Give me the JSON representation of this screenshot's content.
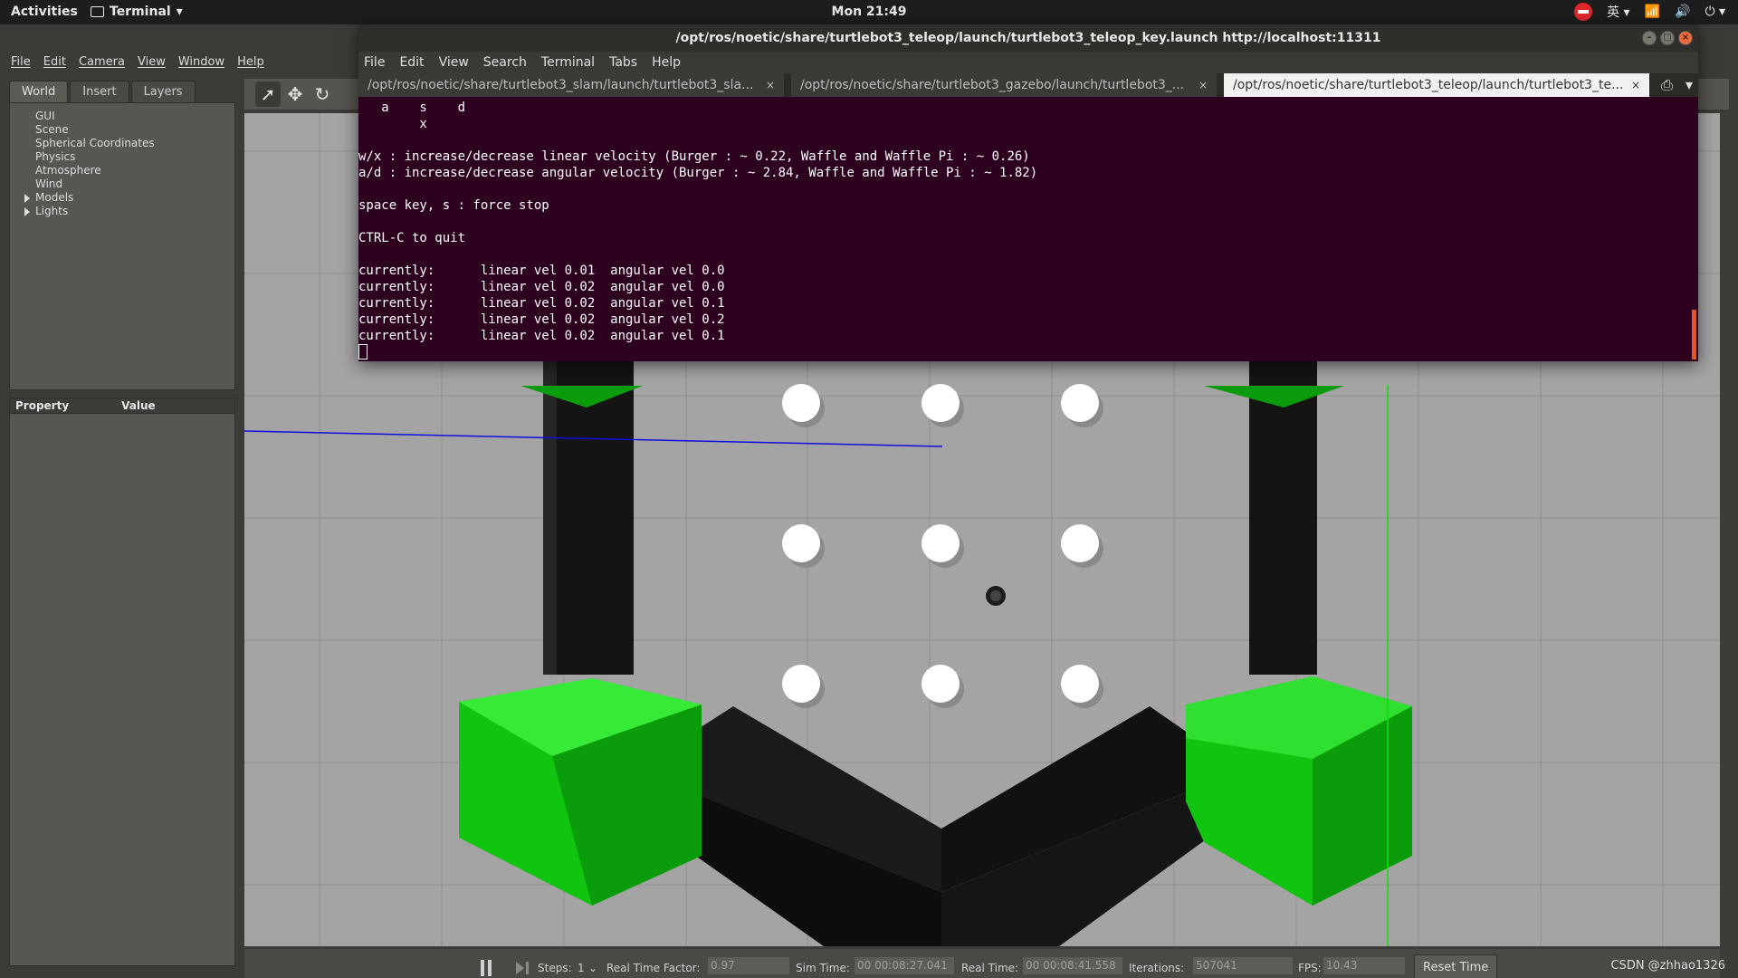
{
  "topbar": {
    "activities": "Activities",
    "app_menu": "Terminal",
    "clock": "Mon 21:49",
    "ime": "英"
  },
  "gazebo": {
    "menu": [
      "File",
      "Edit",
      "Camera",
      "View",
      "Window",
      "Help"
    ],
    "tabs": [
      "World",
      "Insert",
      "Layers"
    ],
    "world_tree": [
      {
        "label": "GUI",
        "expandable": false
      },
      {
        "label": "Scene",
        "expandable": false
      },
      {
        "label": "Spherical Coordinates",
        "expandable": false
      },
      {
        "label": "Physics",
        "expandable": false
      },
      {
        "label": "Atmosphere",
        "expandable": false
      },
      {
        "label": "Wind",
        "expandable": false
      },
      {
        "label": "Models",
        "expandable": true
      },
      {
        "label": "Lights",
        "expandable": true
      }
    ],
    "property_header": {
      "property": "Property",
      "value": "Value"
    },
    "bottom": {
      "steps_label": "Steps:",
      "steps_value": "1",
      "rtf_label": "Real Time Factor:",
      "rtf_value": "0.97",
      "sim_time_label": "Sim Time:",
      "sim_time_value": "00 00:08:27.041",
      "real_time_label": "Real Time:",
      "real_time_value": "00 00:08:41.558",
      "iterations_label": "Iterations:",
      "iterations_value": "507041",
      "fps_label": "FPS:",
      "fps_value": "10.43",
      "reset_time": "Reset Time"
    },
    "watermark": "CSDN @zhhao1326"
  },
  "terminal": {
    "title": "/opt/ros/noetic/share/turtlebot3_teleop/launch/turtlebot3_teleop_key.launch http://localhost:11311",
    "menu": [
      "File",
      "Edit",
      "View",
      "Search",
      "Terminal",
      "Tabs",
      "Help"
    ],
    "tabs": [
      {
        "label": "/opt/ros/noetic/share/turtlebot3_slam/launch/turtlebot3_sla...",
        "active": false
      },
      {
        "label": "/opt/ros/noetic/share/turtlebot3_gazebo/launch/turtlebot3_...",
        "active": false
      },
      {
        "label": "/opt/ros/noetic/share/turtlebot3_teleop/launch/turtlebot3_te...",
        "active": true
      }
    ],
    "lines": [
      "   a    s    d",
      "        x",
      "",
      "w/x : increase/decrease linear velocity (Burger : ~ 0.22, Waffle and Waffle Pi : ~ 0.26)",
      "a/d : increase/decrease angular velocity (Burger : ~ 2.84, Waffle and Waffle Pi : ~ 1.82)",
      "",
      "space key, s : force stop",
      "",
      "CTRL-C to quit",
      "",
      "currently:      linear vel 0.01  angular vel 0.0",
      "currently:      linear vel 0.02  angular vel 0.0",
      "currently:      linear vel 0.02  angular vel 0.1",
      "currently:      linear vel 0.02  angular vel 0.2",
      "currently:      linear vel 0.02  angular vel 0.1"
    ]
  },
  "colors": {
    "terminal_bg": "#2c001e",
    "hex_green": "#0fbf0f",
    "wall_black": "#141414",
    "viewport_gray": "#a4a4a4",
    "ubuntu_orange": "#e95420"
  }
}
